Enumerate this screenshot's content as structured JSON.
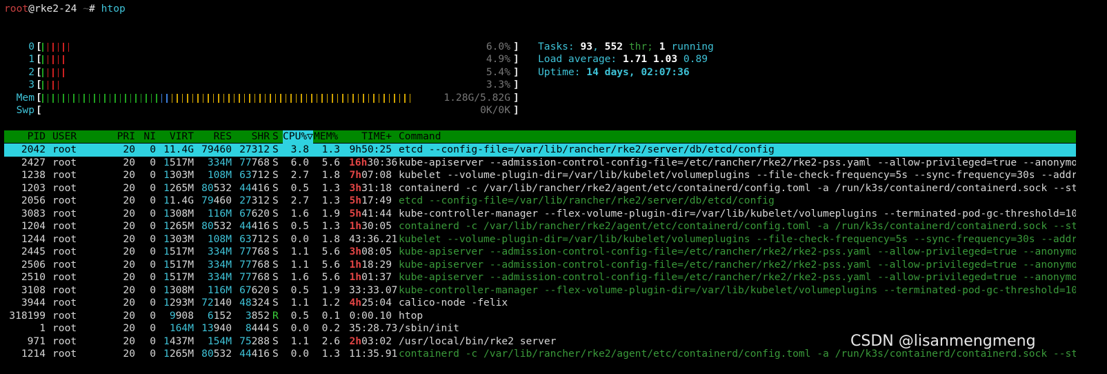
{
  "prompt": {
    "user": "root",
    "at": "@",
    "host": "rke2-24",
    "sep": " ~",
    "hash": "# ",
    "command": "htop"
  },
  "meters": [
    {
      "label": "0",
      "value": "6.0%",
      "bars": 6,
      "color": "#cc2020"
    },
    {
      "label": "1",
      "value": "4.9%",
      "bars": 5,
      "color": "#cc2020"
    },
    {
      "label": "2",
      "value": "5.4%",
      "bars": 5,
      "color": "#cc2020"
    },
    {
      "label": "3",
      "value": "3.3%",
      "bars": 4,
      "color": "#cc2020"
    },
    {
      "label": "Mem",
      "value": "1.28G/5.82G",
      "bars": 72,
      "color": "#d2a400"
    },
    {
      "label": "Swp",
      "value": "0K/0K",
      "bars": 0,
      "color": "#cc2020"
    }
  ],
  "info": {
    "tasks_label": "Tasks: ",
    "tasks": "93",
    "comma": ", ",
    "threads": "552",
    "thr_label": " thr; ",
    "running": "1",
    "running_label": " running",
    "load_label": "Load average: ",
    "load1": "1.71",
    "load5": "1.03",
    "load15": "0.89",
    "uptime_label": "Uptime: ",
    "uptime": "14 days, 02:07:36"
  },
  "header": {
    "pid": "PID",
    "user": "USER",
    "pri": "PRI",
    "ni": "NI",
    "virt": "VIRT",
    "res": "RES",
    "shr": "SHR",
    "s": "S",
    "cpu": "CPU%▽",
    "mem": "MEM%",
    "time": "TIME+",
    "command": "Command"
  },
  "processes": [
    {
      "pid": "2042",
      "user": "root",
      "pri": "20",
      "ni": "0",
      "virt": "11.4G",
      "res": "79460",
      "shr": "27312",
      "s": "S",
      "cpu": "3.8",
      "mem": "1.3",
      "time": "9h50:25",
      "command": "etcd --config-file=/var/lib/rancher/rke2/server/db/etcd/config",
      "thread": false,
      "selected": true
    },
    {
      "pid": "2427",
      "user": "root",
      "pri": "20",
      "ni": "0",
      "virt": "1517M",
      "res": "334M",
      "shr": "77768",
      "s": "S",
      "cpu": "6.0",
      "mem": "5.6",
      "time": "16h30:36",
      "command": "kube-apiserver --admission-control-config-file=/etc/rancher/rke2/rke2-pss.yaml --allow-privileged=true --anonymo",
      "thread": false
    },
    {
      "pid": "1238",
      "user": "root",
      "pri": "20",
      "ni": "0",
      "virt": "1303M",
      "res": "108M",
      "shr": "63712",
      "s": "S",
      "cpu": "2.7",
      "mem": "1.8",
      "time": "7h07:08",
      "command": "kubelet --volume-plugin-dir=/var/lib/kubelet/volumeplugins --file-check-frequency=5s --sync-frequency=30s --addr",
      "thread": false
    },
    {
      "pid": "1203",
      "user": "root",
      "pri": "20",
      "ni": "0",
      "virt": "1265M",
      "res": "80532",
      "shr": "44416",
      "s": "S",
      "cpu": "0.5",
      "mem": "1.3",
      "time": "3h31:18",
      "command": "containerd -c /var/lib/rancher/rke2/agent/etc/containerd/config.toml -a /run/k3s/containerd/containerd.sock --st",
      "thread": false
    },
    {
      "pid": "2056",
      "user": "root",
      "pri": "20",
      "ni": "0",
      "virt": "11.4G",
      "res": "79460",
      "shr": "27312",
      "s": "S",
      "cpu": "2.7",
      "mem": "1.3",
      "time": "5h17:49",
      "command": "etcd --config-file=/var/lib/rancher/rke2/server/db/etcd/config",
      "thread": true
    },
    {
      "pid": "3083",
      "user": "root",
      "pri": "20",
      "ni": "0",
      "virt": "1308M",
      "res": "116M",
      "shr": "67620",
      "s": "S",
      "cpu": "1.6",
      "mem": "1.9",
      "time": "5h41:44",
      "command": "kube-controller-manager --flex-volume-plugin-dir=/var/lib/kubelet/volumeplugins --terminated-pod-gc-threshold=10",
      "thread": false
    },
    {
      "pid": "1204",
      "user": "root",
      "pri": "20",
      "ni": "0",
      "virt": "1265M",
      "res": "80532",
      "shr": "44416",
      "s": "S",
      "cpu": "0.5",
      "mem": "1.3",
      "time": "1h30:05",
      "command": "containerd -c /var/lib/rancher/rke2/agent/etc/containerd/config.toml -a /run/k3s/containerd/containerd.sock --st",
      "thread": true
    },
    {
      "pid": "1244",
      "user": "root",
      "pri": "20",
      "ni": "0",
      "virt": "1303M",
      "res": "108M",
      "shr": "63712",
      "s": "S",
      "cpu": "0.0",
      "mem": "1.8",
      "time": "43:36.21",
      "command": "kubelet --volume-plugin-dir=/var/lib/kubelet/volumeplugins --file-check-frequency=5s --sync-frequency=30s --addr",
      "thread": true
    },
    {
      "pid": "2445",
      "user": "root",
      "pri": "20",
      "ni": "0",
      "virt": "1517M",
      "res": "334M",
      "shr": "77768",
      "s": "S",
      "cpu": "1.1",
      "mem": "5.6",
      "time": "3h08:05",
      "command": "kube-apiserver --admission-control-config-file=/etc/rancher/rke2/rke2-pss.yaml --allow-privileged=true --anonymo",
      "thread": true
    },
    {
      "pid": "2506",
      "user": "root",
      "pri": "20",
      "ni": "0",
      "virt": "1517M",
      "res": "334M",
      "shr": "77768",
      "s": "S",
      "cpu": "1.1",
      "mem": "5.6",
      "time": "1h18:29",
      "command": "kube-apiserver --admission-control-config-file=/etc/rancher/rke2/rke2-pss.yaml --allow-privileged=true --anonymo",
      "thread": true
    },
    {
      "pid": "2510",
      "user": "root",
      "pri": "20",
      "ni": "0",
      "virt": "1517M",
      "res": "334M",
      "shr": "77768",
      "s": "S",
      "cpu": "1.6",
      "mem": "5.6",
      "time": "1h01:37",
      "command": "kube-apiserver --admission-control-config-file=/etc/rancher/rke2/rke2-pss.yaml --allow-privileged=true --anonymo",
      "thread": true
    },
    {
      "pid": "3108",
      "user": "root",
      "pri": "20",
      "ni": "0",
      "virt": "1308M",
      "res": "116M",
      "shr": "67620",
      "s": "S",
      "cpu": "0.5",
      "mem": "1.9",
      "time": "33:33.07",
      "command": "kube-controller-manager --flex-volume-plugin-dir=/var/lib/kubelet/volumeplugins --terminated-pod-gc-threshold=10",
      "thread": true
    },
    {
      "pid": "3944",
      "user": "root",
      "pri": "20",
      "ni": "0",
      "virt": "1293M",
      "res": "72140",
      "shr": "48324",
      "s": "S",
      "cpu": "1.1",
      "mem": "1.2",
      "time": "4h25:04",
      "command": "calico-node -felix",
      "thread": false
    },
    {
      "pid": "318199",
      "user": "root",
      "pri": "20",
      "ni": "0",
      "virt": "9908",
      "res": "6152",
      "shr": "3852",
      "s": "R",
      "cpu": "0.5",
      "mem": "0.1",
      "time": "0:00.10",
      "command": "htop",
      "thread": false
    },
    {
      "pid": "1",
      "user": "root",
      "pri": "20",
      "ni": "0",
      "virt": "164M",
      "res": "13940",
      "shr": "8444",
      "s": "S",
      "cpu": "0.0",
      "mem": "0.2",
      "time": "35:28.73",
      "command": "/sbin/init",
      "thread": false
    },
    {
      "pid": "971",
      "user": "root",
      "pri": "20",
      "ni": "0",
      "virt": "1437M",
      "res": "154M",
      "shr": "75288",
      "s": "S",
      "cpu": "1.1",
      "mem": "2.6",
      "time": "2h03:02",
      "command": "/usr/local/bin/rke2 server",
      "thread": false
    },
    {
      "pid": "1214",
      "user": "root",
      "pri": "20",
      "ni": "0",
      "virt": "1265M",
      "res": "80532",
      "shr": "44416",
      "s": "S",
      "cpu": "0.0",
      "mem": "1.3",
      "time": "11:35.91",
      "command": "containerd -c /var/lib/rancher/rke2/agent/etc/containerd/config.toml -a /run/k3s/containerd/containerd.sock --st",
      "thread": true
    }
  ],
  "watermark": "CSDN @lisanmengmeng"
}
